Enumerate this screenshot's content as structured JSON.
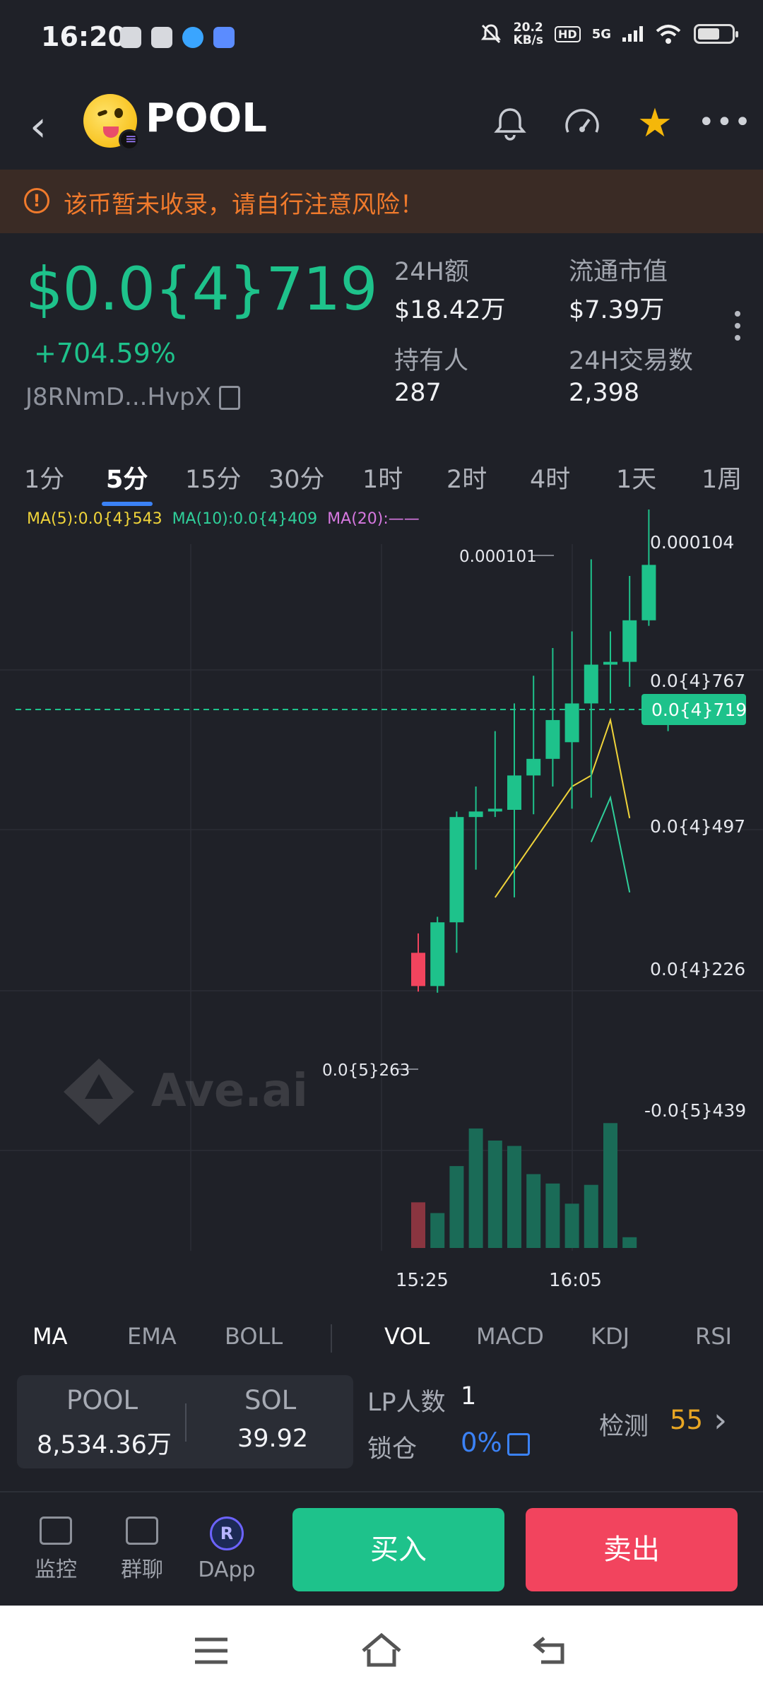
{
  "status_bar": {
    "time": "16:20",
    "net_speed_top": "20.2",
    "net_speed_unit": "KB/s",
    "hd": "HD",
    "network": "5G",
    "icons": [
      "wechat-icon",
      "link-icon",
      "qq-icon",
      "app-icon",
      "mute-icon",
      "wifi-icon",
      "battery-icon"
    ]
  },
  "header": {
    "token_name": "POOL",
    "icons": [
      "back-icon",
      "bell-icon",
      "gauge-icon",
      "star-icon",
      "more-icon"
    ]
  },
  "warning": {
    "text": "该币暂未收录，请自行注意风险！"
  },
  "price_panel": {
    "price": "$0.0{4}719",
    "change": "+704.59%",
    "address": "J8RNmD...HvpX",
    "stats": [
      {
        "label": "24H额",
        "value": "$18.42万"
      },
      {
        "label": "流通市值",
        "value": "$7.39万"
      },
      {
        "label": "持有人",
        "value": "287"
      },
      {
        "label": "24H交易数",
        "value": "2,398"
      }
    ]
  },
  "timeframes": [
    "1分",
    "5分",
    "15分",
    "30分",
    "1时",
    "2时",
    "4时",
    "1天",
    "1周"
  ],
  "active_timeframe": "5分",
  "chart": {
    "ma_legend": {
      "ma5": "MA(5):0.0{4}543",
      "ma10": "MA(10):0.0{4}409",
      "ma20": "MA(20):——"
    },
    "ma5_color": "#f0d43a",
    "ma10_color": "#2fcf9a",
    "ma20_color": "#d678e0",
    "up_color": "#1ec28b",
    "down_color": "#f2445e",
    "y_labels": [
      "0.000104",
      "0.0{4}767",
      "0.0{4}497",
      "0.0{4}226",
      "-0.0{5}439"
    ],
    "current_price_tag": "0.0{4}719",
    "high_annotation": "0.000101",
    "low_annotation": "0.0{5}263",
    "x_labels": [
      "15:25",
      "16:05"
    ],
    "watermark": "Ave.ai"
  },
  "chart_data": {
    "type": "candlestick",
    "ylim": [
      -4.39e-06,
      0.000104
    ],
    "candles": [
      {
        "o": 3e-05,
        "c": 2.4e-05,
        "h": 3.35e-05,
        "l": 2.3e-05
      },
      {
        "o": 2.4e-05,
        "c": 3.55e-05,
        "h": 3.65e-05,
        "l": 2.28e-05
      },
      {
        "o": 3.55e-05,
        "c": 5.45e-05,
        "h": 5.55e-05,
        "l": 3e-05
      },
      {
        "o": 5.45e-05,
        "c": 5.55e-05,
        "h": 6e-05,
        "l": 4.5e-05
      },
      {
        "o": 5.55e-05,
        "c": 5.6e-05,
        "h": 7e-05,
        "l": 5.45e-05
      },
      {
        "o": 5.58e-05,
        "c": 6.2e-05,
        "h": 7.5e-05,
        "l": 4e-05
      },
      {
        "o": 6.2e-05,
        "c": 6.5e-05,
        "h": 8e-05,
        "l": 5.5e-05
      },
      {
        "o": 6.5e-05,
        "c": 7.2e-05,
        "h": 8.5e-05,
        "l": 6e-05
      },
      {
        "o": 6.8e-05,
        "c": 7.5e-05,
        "h": 8.8e-05,
        "l": 5.6e-05
      },
      {
        "o": 7.5e-05,
        "c": 8.2e-05,
        "h": 0.000101,
        "l": 5.8e-05
      },
      {
        "o": 8.2e-05,
        "c": 8.25e-05,
        "h": 8.8e-05,
        "l": 7.5e-05
      },
      {
        "o": 8.25e-05,
        "c": 9e-05,
        "h": 9.8e-05,
        "l": 7.8e-05
      },
      {
        "o": 9e-05,
        "c": 0.0001,
        "h": 0.00011,
        "l": 8.9e-05
      },
      {
        "o": 7.19e-05,
        "c": 7.25e-05,
        "h": 7.67e-05,
        "l": 7e-05
      }
    ],
    "volumes": [
      0.34,
      0.26,
      0.61,
      0.89,
      0.8,
      0.76,
      0.55,
      0.48,
      0.33,
      0.47,
      0.93,
      0.08
    ],
    "volume_colors": [
      "down",
      "up",
      "up",
      "up",
      "up",
      "up",
      "up",
      "up",
      "up",
      "up",
      "up",
      "up"
    ],
    "ma5": [
      null,
      null,
      null,
      null,
      4e-05,
      4.5e-05,
      5e-05,
      5.5e-05,
      6e-05,
      6.2e-05,
      7.2e-05,
      5.43e-05
    ],
    "ma10": [
      null,
      null,
      null,
      null,
      null,
      null,
      null,
      null,
      null,
      5e-05,
      5.8e-05,
      4.09e-05
    ]
  },
  "indicator_tabs": {
    "main": [
      "MA",
      "EMA",
      "BOLL"
    ],
    "sub": [
      "VOL",
      "MACD",
      "KDJ",
      "RSI"
    ],
    "active_main": "MA",
    "active_sub": "VOL"
  },
  "pool_info": {
    "token_label": "POOL",
    "token_amount": "8,534.36万",
    "quote_label": "SOL",
    "quote_amount": "39.92",
    "lp_label": "LP人数",
    "lp_value": "1",
    "lock_label": "锁仓",
    "lock_value": "0%",
    "detect_label": "检测",
    "detect_value": "55"
  },
  "bottom_nav": {
    "monitor": "监控",
    "group_chat": "群聊",
    "dapp": "DApp",
    "buy": "买入",
    "sell": "卖出"
  }
}
